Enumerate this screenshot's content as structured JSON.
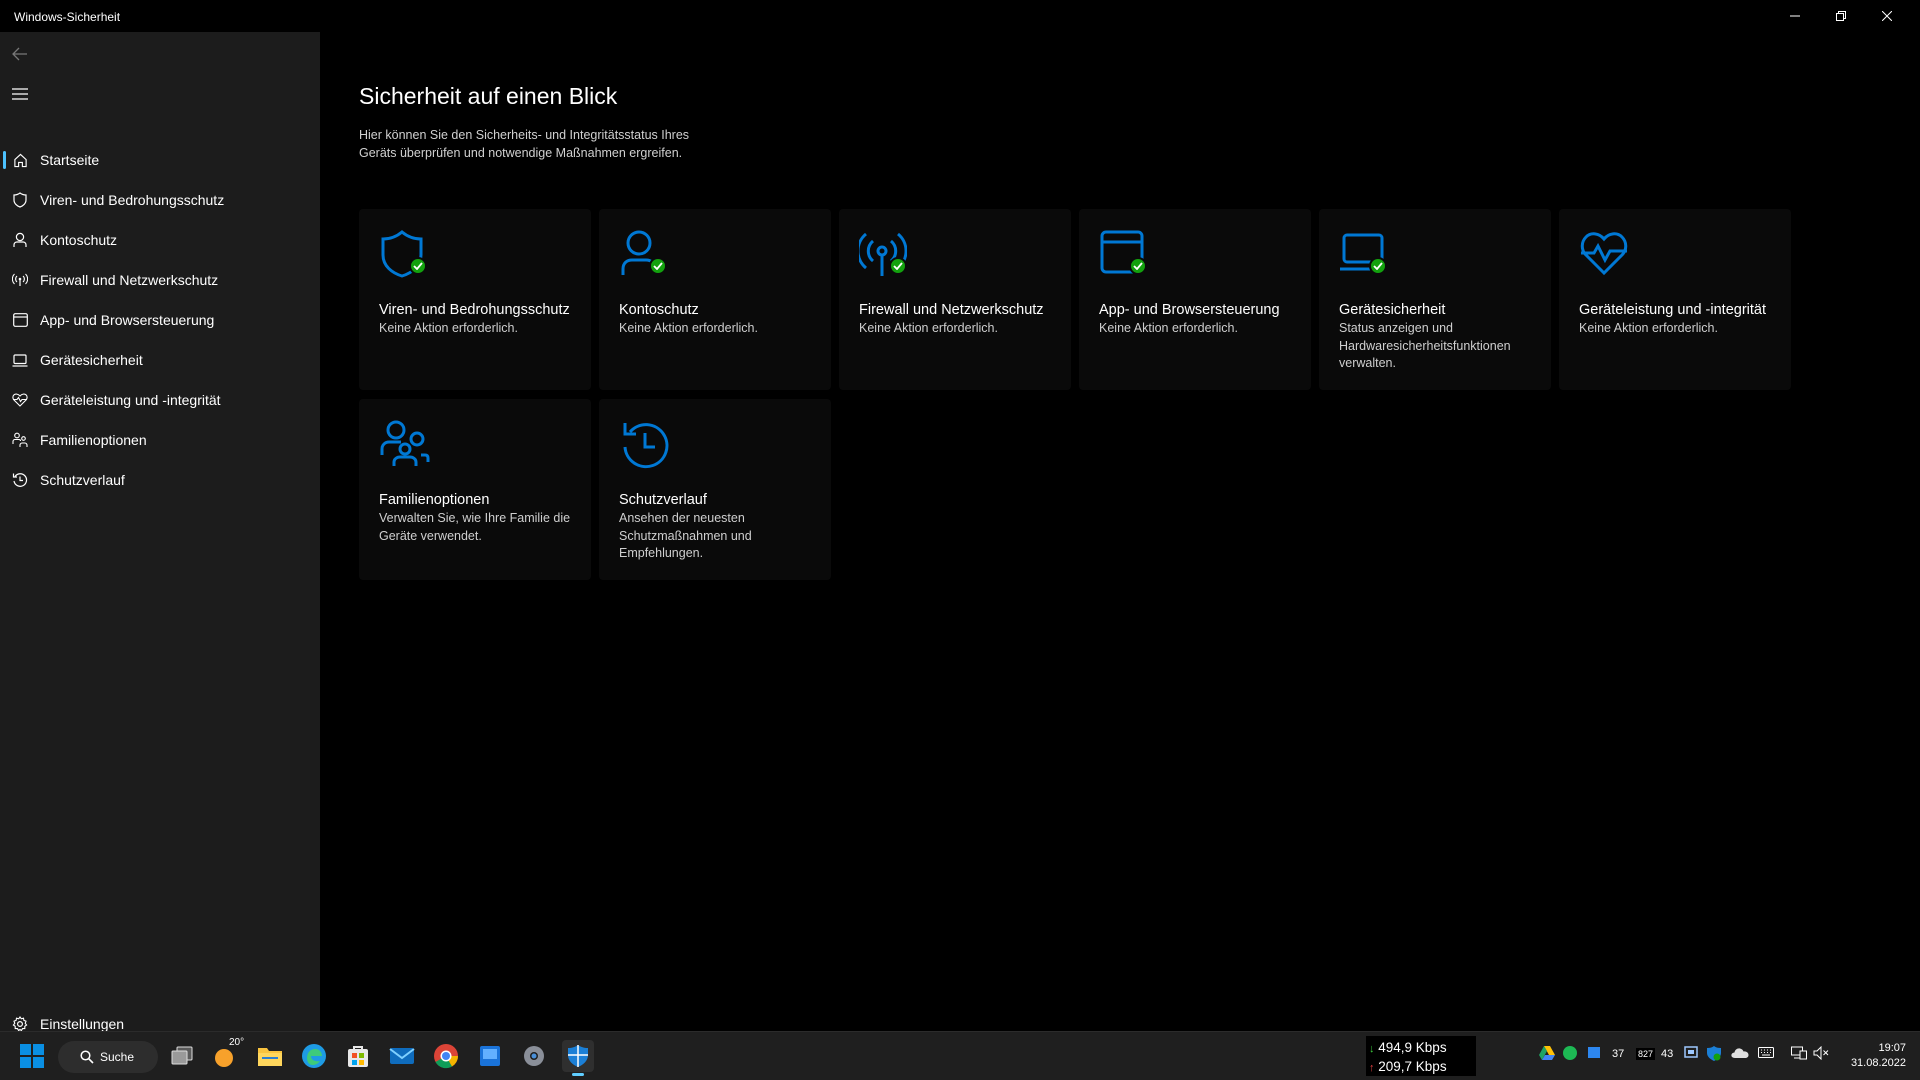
{
  "window": {
    "title": "Windows-Sicherheit"
  },
  "sidebar": {
    "items": [
      {
        "label": "Startseite"
      },
      {
        "label": "Viren- und Bedrohungsschutz"
      },
      {
        "label": "Kontoschutz"
      },
      {
        "label": "Firewall und Netzwerkschutz"
      },
      {
        "label": "App- und Browsersteuerung"
      },
      {
        "label": "Gerätesicherheit"
      },
      {
        "label": "Geräteleistung und -integrität"
      },
      {
        "label": "Familienoptionen"
      },
      {
        "label": "Schutzverlauf"
      }
    ],
    "settings_label": "Einstellungen"
  },
  "main": {
    "title": "Sicherheit auf einen Blick",
    "description": "Hier können Sie den Sicherheits- und Integritätsstatus Ihres Geräts überprüfen und notwendige Maßnahmen ergreifen.",
    "cards": [
      {
        "title": "Viren- und Bedrohungsschutz",
        "desc": "Keine Aktion erforderlich.",
        "icon": "shield-icon",
        "status": "ok"
      },
      {
        "title": "Kontoschutz",
        "desc": "Keine Aktion erforderlich.",
        "icon": "person-icon",
        "status": "ok"
      },
      {
        "title": "Firewall und Netzwerkschutz",
        "desc": "Keine Aktion erforderlich.",
        "icon": "antenna-icon",
        "status": "ok"
      },
      {
        "title": "App- und Browsersteuerung",
        "desc": "Keine Aktion erforderlich.",
        "icon": "browser-window-icon",
        "status": "ok"
      },
      {
        "title": "Gerätesicherheit",
        "desc": "Status anzeigen und Hardwaresicherheitsfunktionen verwalten.",
        "icon": "laptop-icon",
        "status": "ok"
      },
      {
        "title": "Geräteleistung und -integrität",
        "desc": "Keine Aktion erforderlich.",
        "icon": "heart-pulse-icon",
        "status": "none"
      },
      {
        "title": "Familienoptionen",
        "desc": "Verwalten Sie, wie Ihre Familie die Geräte verwendet.",
        "icon": "family-icon",
        "status": "none"
      },
      {
        "title": "Schutzverlauf",
        "desc": "Ansehen der neuesten Schutzmaßnahmen und Empfehlungen.",
        "icon": "history-icon",
        "status": "none"
      }
    ]
  },
  "taskbar": {
    "search_label": "Suche",
    "weather_temp": "20°",
    "net_down": "494,9 Kbps",
    "net_up": "209,7 Kbps",
    "tray_num1": "37",
    "tray_num2": "827",
    "tray_num3": "43",
    "time": "19:07",
    "date": "31.08.2022"
  },
  "colors": {
    "accent": "#4cc2ff",
    "icon_blue": "#0078d4",
    "status_green": "#13a10e",
    "sidebar_bg": "#1c1c1c"
  }
}
